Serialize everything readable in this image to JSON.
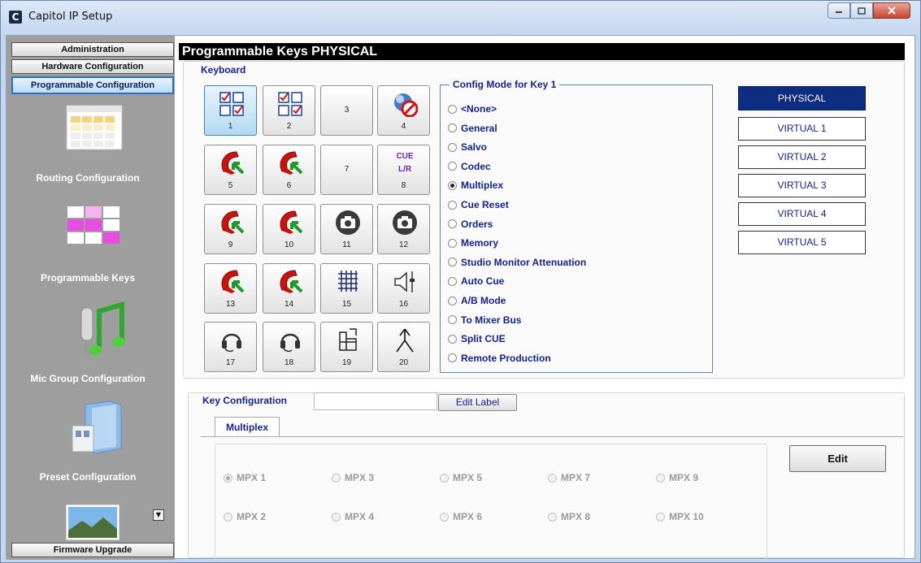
{
  "window": {
    "title": "Capitol IP Setup",
    "icon_letter": "C"
  },
  "sidebar": {
    "top_buttons": [
      "Administration",
      "Hardware Configuration",
      "Programmable Configuration"
    ],
    "nav_items": [
      "Routing Configuration",
      "Programmable Keys",
      "Mic Group Configuration",
      "Preset Configuration"
    ],
    "bottom_button": "Firmware Upgrade"
  },
  "main": {
    "title": "Programmable Keys PHYSICAL",
    "keyboard_label": "Keyboard",
    "keys": [
      {
        "num": "1",
        "icon": "checkbox-grid-icon"
      },
      {
        "num": "2",
        "icon": "checkbox-grid-icon"
      },
      {
        "num": "3",
        "icon": ""
      },
      {
        "num": "4",
        "icon": "no-talk-icon"
      },
      {
        "num": "5",
        "icon": "phone-handset-icon"
      },
      {
        "num": "6",
        "icon": "phone-handset-icon"
      },
      {
        "num": "7",
        "icon": ""
      },
      {
        "num": "8",
        "icon": "cue-lr-icon",
        "cue_text": "CUE",
        "lr_text": "L/R"
      },
      {
        "num": "9",
        "icon": "phone-handset-icon"
      },
      {
        "num": "10",
        "icon": "phone-handset-icon"
      },
      {
        "num": "11",
        "icon": "camera-icon"
      },
      {
        "num": "12",
        "icon": "camera-icon"
      },
      {
        "num": "13",
        "icon": "phone-handset-icon"
      },
      {
        "num": "14",
        "icon": "phone-handset-icon"
      },
      {
        "num": "15",
        "icon": "matrix-grid-icon"
      },
      {
        "num": "16",
        "icon": "speaker-fader-icon"
      },
      {
        "num": "17",
        "icon": "headset-icon"
      },
      {
        "num": "18",
        "icon": "headset-icon"
      },
      {
        "num": "19",
        "icon": "mixer-bus-icon"
      },
      {
        "num": "20",
        "icon": "split-arrow-icon"
      }
    ],
    "config_mode_title": "Config Mode for Key 1",
    "config_modes": [
      "<None>",
      "General",
      "Salvo",
      "Codec",
      "Multiplex",
      "Cue Reset",
      "Orders",
      "Memory",
      "Studio Monitor Attenuation",
      "Auto Cue",
      "A/B Mode",
      "To Mixer Bus",
      "Split CUE",
      "Remote Production"
    ],
    "selected_mode": "Multiplex",
    "mode_buttons": [
      "PHYSICAL",
      "VIRTUAL 1",
      "VIRTUAL 2",
      "VIRTUAL 3",
      "VIRTUAL 4",
      "VIRTUAL 5"
    ],
    "active_mode_button": "PHYSICAL"
  },
  "key_config": {
    "label": "Key Configuration",
    "label_value": "",
    "edit_label_button": "Edit Label",
    "tab": "Multiplex",
    "mpx_options": [
      "MPX 1",
      "MPX 3",
      "MPX 5",
      "MPX 7",
      "MPX 9",
      "MPX 2",
      "MPX 4",
      "MPX 6",
      "MPX 8",
      "MPX 10"
    ],
    "selected_mpx": "MPX 1",
    "edit_button": "Edit"
  },
  "colors": {
    "accent_dark_blue": "#0f2d80",
    "label_blue": "#14238c",
    "sidebar_gray": "#9e9e9e"
  }
}
